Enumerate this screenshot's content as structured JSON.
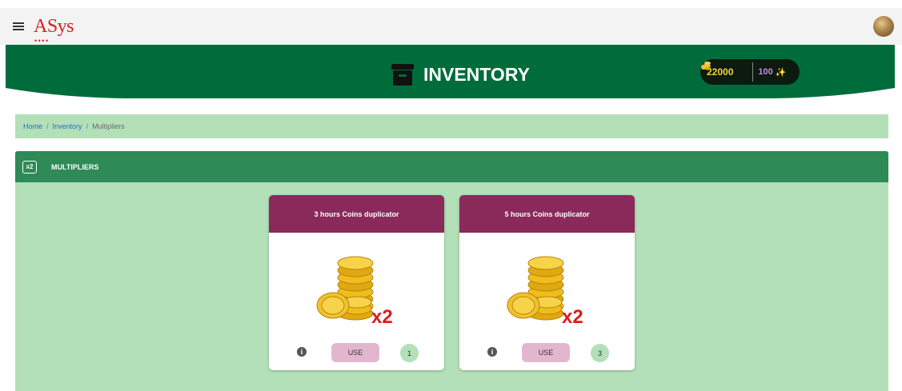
{
  "topbar": {
    "logo_text": "ASys",
    "logo_dots": "••••",
    "menu_icon": "hamburger-icon",
    "avatar_icon": "user-avatar"
  },
  "header": {
    "title": "INVENTORY",
    "title_icon": "archive-box-icon",
    "coins": "22000",
    "coins_icon": "coins-icon",
    "gems": "100",
    "gems_icon": "gem-icon",
    "colors": {
      "banner": "#006c3c",
      "wallet_bg": "#0d1a10",
      "coins": "#f4d43a",
      "gems": "#c58ae6"
    }
  },
  "breadcrumb": {
    "items": [
      {
        "label": "Home"
      },
      {
        "label": "Inventory"
      },
      {
        "label": "Multipliers"
      }
    ],
    "separator": "/"
  },
  "panel": {
    "title": "MULTIPLIERS",
    "icon_text": "x2",
    "colors": {
      "header": "#2e8a56",
      "body": "#b3dfb9"
    }
  },
  "cards": [
    {
      "title": "3 hours Coins duplicator",
      "multiplier": "x2",
      "use_label": "USE",
      "quantity": "1",
      "info": "i"
    },
    {
      "title": "5 hours Coins duplicator",
      "multiplier": "x2",
      "use_label": "USE",
      "quantity": "3",
      "info": "i"
    }
  ],
  "colors": {
    "card_header": "#8a2a5a",
    "use_button": "#e3b6d0"
  }
}
